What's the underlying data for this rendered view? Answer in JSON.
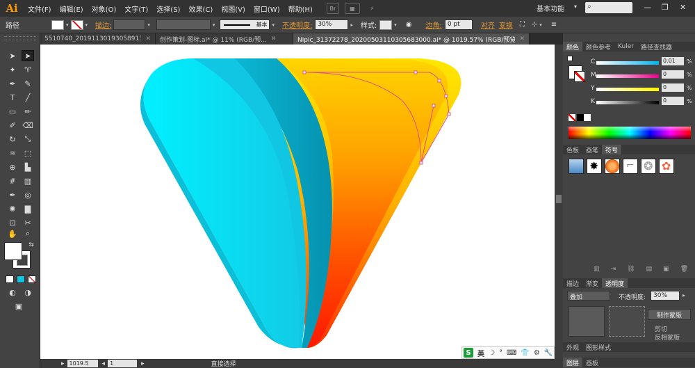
{
  "app": {
    "logo": "Ai"
  },
  "menu": [
    "文件(F)",
    "编辑(E)",
    "对象(O)",
    "文字(T)",
    "选择(S)",
    "效果(C)",
    "视图(V)",
    "窗口(W)",
    "帮助(H)"
  ],
  "menubar_buttons": {
    "bridge": "Br",
    "arrange": "▦",
    "gpu": "⚡"
  },
  "workspace": {
    "label": "基本功能",
    "arrow": "▾"
  },
  "search": {
    "icon": "search-icon",
    "placeholder": ""
  },
  "window_controls": {
    "minimize": "—",
    "restore": "❐",
    "close": "✕"
  },
  "control_bar": {
    "selection": "路径",
    "stroke_label": "描边:",
    "stroke_style": "基本",
    "opacity_label": "不透明度:",
    "opacity_value": "30%",
    "style_label": "样式:",
    "corner_label": "边角:",
    "corner_value": "0 pt",
    "align_label": "对齐",
    "transform_label": "变换",
    "arrow": "▾",
    "small_arrow": "▸"
  },
  "tabs": [
    {
      "label": "5510740_20191130193058913081.ai*",
      "active": false
    },
    {
      "label": "创作策划-图标.ai* @ 11% (RGB/预...",
      "active": false
    },
    {
      "label": "Nipic_31372278_20200503110305683000.ai* @ 1019.57% (RGB/预览)",
      "active": true
    }
  ],
  "tab_close": "✕",
  "tools": {
    "selection": "➤",
    "direct_selection": "➤",
    "magic_wand": "✦",
    "lasso": "♈",
    "pen": "✒",
    "curvature": "✎",
    "type": "T",
    "line": "╱",
    "rectangle": "▭",
    "paintbrush": "✏",
    "pencil": "✐",
    "eraser": "⌫",
    "rotate": "↻",
    "scale": "⤡",
    "warp": "♒",
    "free_transform": "⬚",
    "shape_builder": "⊕",
    "perspective": "▙",
    "mesh": "#",
    "gradient": "▥",
    "eyedropper": "✒",
    "blend": "◎",
    "symbol_sprayer": "✺",
    "column_graph": "▇",
    "artboard": "⊡",
    "slice": "✂",
    "hand": "✋",
    "zoom": "🔍",
    "swap": "⇆"
  },
  "panels": {
    "color": {
      "tabs": [
        "颜色",
        "颜色参考",
        "Kuler",
        "路径查找器"
      ],
      "channels": [
        {
          "letter": "C",
          "value": "0.01"
        },
        {
          "letter": "M",
          "value": "0"
        },
        {
          "letter": "Y",
          "value": "0"
        },
        {
          "letter": "K",
          "value": "0"
        }
      ],
      "pct": "%"
    },
    "swatches": {
      "tabs": [
        "色板",
        "画笔",
        "符号"
      ]
    },
    "transparency": {
      "tabs": [
        "描边",
        "渐变",
        "透明度"
      ],
      "blend_mode": "叠加",
      "opacity_label": "不透明度:",
      "opacity_value": "30%",
      "mask_button": "制作蒙版",
      "clip_label": "剪切",
      "invert_label": "反相蒙版"
    },
    "bottom_tabs": [
      "外观",
      "图形样式"
    ],
    "layer_tabs": [
      "图层",
      "画板"
    ]
  },
  "status": {
    "zoom": "1019.5",
    "artboard": "1",
    "tool": "直接选择"
  },
  "ime": {
    "logo": "S",
    "lang": "英",
    "icons": [
      "☽",
      "°",
      "⌨",
      "👕",
      "⚙",
      "🔧"
    ]
  },
  "colors": {
    "cyan_left": "#00f0ff",
    "cyan_mid": "#10c8e6",
    "teal": "#06a8c4",
    "orange_top": "#ffd500",
    "orange_bottom": "#ff1800",
    "yellow_rim": "#ffe800",
    "path": "#e0508a"
  }
}
